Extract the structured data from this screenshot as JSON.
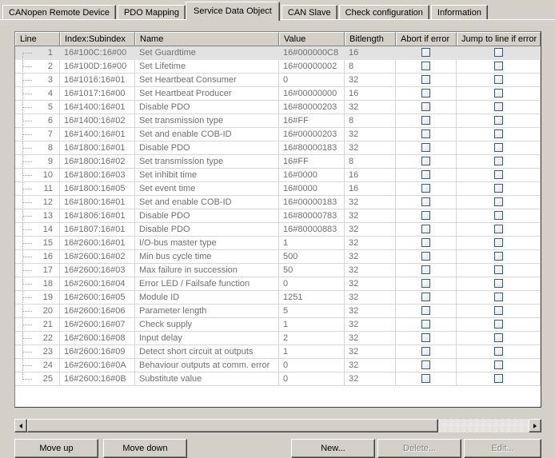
{
  "tabs": [
    {
      "label": "CANopen Remote Device",
      "active": false
    },
    {
      "label": "PDO Mapping",
      "active": false
    },
    {
      "label": "Service Data Object",
      "active": true
    },
    {
      "label": "CAN Slave",
      "active": false
    },
    {
      "label": "Check configuration",
      "active": false
    },
    {
      "label": "Information",
      "active": false
    }
  ],
  "grid": {
    "columns": [
      {
        "key": "line",
        "label": "Line"
      },
      {
        "key": "index",
        "label": "Index:Subindex"
      },
      {
        "key": "name",
        "label": "Name"
      },
      {
        "key": "value",
        "label": "Value"
      },
      {
        "key": "bit",
        "label": "Bitlength"
      },
      {
        "key": "abort",
        "label": "Abort if error"
      },
      {
        "key": "jump",
        "label": "Jump to line if error"
      }
    ],
    "selected_row": 1,
    "rows": [
      {
        "line": "1",
        "index": "16#100C:16#00",
        "name": "Set Guardtime",
        "value": "16#000000C8",
        "bit": "16",
        "abort": false,
        "jump": false
      },
      {
        "line": "2",
        "index": "16#100D:16#00",
        "name": "Set Lifetime",
        "value": "16#00000002",
        "bit": "8",
        "abort": false,
        "jump": false
      },
      {
        "line": "3",
        "index": "16#1016:16#01",
        "name": "Set Heartbeat Consumer",
        "value": "0",
        "bit": "32",
        "abort": false,
        "jump": false
      },
      {
        "line": "4",
        "index": "16#1017:16#00",
        "name": "Set Heartbeat Producer",
        "value": "16#00000000",
        "bit": "16",
        "abort": false,
        "jump": false
      },
      {
        "line": "5",
        "index": "16#1400:16#01",
        "name": "Disable PDO",
        "value": "16#80000203",
        "bit": "32",
        "abort": false,
        "jump": false
      },
      {
        "line": "6",
        "index": "16#1400:16#02",
        "name": "Set transmission type",
        "value": "16#FF",
        "bit": "8",
        "abort": false,
        "jump": false
      },
      {
        "line": "7",
        "index": "16#1400:16#01",
        "name": "Set and enable COB-ID",
        "value": "16#00000203",
        "bit": "32",
        "abort": false,
        "jump": false
      },
      {
        "line": "8",
        "index": "16#1800:16#01",
        "name": "Disable PDO",
        "value": "16#80000183",
        "bit": "32",
        "abort": false,
        "jump": false
      },
      {
        "line": "9",
        "index": "16#1800:16#02",
        "name": "Set transmission type",
        "value": "16#FF",
        "bit": "8",
        "abort": false,
        "jump": false
      },
      {
        "line": "10",
        "index": "16#1800:16#03",
        "name": "Set inhibit time",
        "value": "16#0000",
        "bit": "16",
        "abort": false,
        "jump": false
      },
      {
        "line": "11",
        "index": "16#1800:16#05",
        "name": "Set event time",
        "value": "16#0000",
        "bit": "16",
        "abort": false,
        "jump": false
      },
      {
        "line": "12",
        "index": "16#1800:16#01",
        "name": "Set and enable COB-ID",
        "value": "16#00000183",
        "bit": "32",
        "abort": false,
        "jump": false
      },
      {
        "line": "13",
        "index": "16#1806:16#01",
        "name": "Disable PDO",
        "value": "16#80000783",
        "bit": "32",
        "abort": false,
        "jump": false
      },
      {
        "line": "14",
        "index": "16#1807:16#01",
        "name": "Disable PDO",
        "value": "16#80000883",
        "bit": "32",
        "abort": false,
        "jump": false
      },
      {
        "line": "15",
        "index": "16#2600:16#01",
        "name": "I/O-bus master type",
        "value": "1",
        "bit": "32",
        "abort": false,
        "jump": false
      },
      {
        "line": "16",
        "index": "16#2600:16#02",
        "name": "Min bus cycle time",
        "value": "500",
        "bit": "32",
        "abort": false,
        "jump": false
      },
      {
        "line": "17",
        "index": "16#2600:16#03",
        "name": "Max failure in succession",
        "value": "50",
        "bit": "32",
        "abort": false,
        "jump": false
      },
      {
        "line": "18",
        "index": "16#2600:16#04",
        "name": "Error LED / Failsafe function",
        "value": "0",
        "bit": "32",
        "abort": false,
        "jump": false
      },
      {
        "line": "19",
        "index": "16#2600:16#05",
        "name": "Module ID",
        "value": "1251",
        "bit": "32",
        "abort": false,
        "jump": false
      },
      {
        "line": "20",
        "index": "16#2600:16#06",
        "name": "Parameter length",
        "value": "5",
        "bit": "32",
        "abort": false,
        "jump": false
      },
      {
        "line": "21",
        "index": "16#2600:16#07",
        "name": "Check supply",
        "value": "1",
        "bit": "32",
        "abort": false,
        "jump": false
      },
      {
        "line": "22",
        "index": "16#2600:16#08",
        "name": "Input delay",
        "value": "2",
        "bit": "32",
        "abort": false,
        "jump": false
      },
      {
        "line": "23",
        "index": "16#2600:16#09",
        "name": "Detect short circuit at outputs",
        "value": "1",
        "bit": "32",
        "abort": false,
        "jump": false
      },
      {
        "line": "24",
        "index": "16#2600:16#0A",
        "name": "Behaviour outputs at comm. error",
        "value": "0",
        "bit": "32",
        "abort": false,
        "jump": false
      },
      {
        "line": "25",
        "index": "16#2600:16#0B",
        "name": "Substitute value",
        "value": "0",
        "bit": "32",
        "abort": false,
        "jump": false
      }
    ]
  },
  "scrollbar": {
    "thumb_percent": 82
  },
  "buttons": {
    "move_up": {
      "label": "Move up",
      "enabled": true
    },
    "move_down": {
      "label": "Move down",
      "enabled": true
    },
    "new": {
      "label": "New...",
      "enabled": true
    },
    "delete": {
      "label": "Delete...",
      "enabled": false
    },
    "edit": {
      "label": "Edit...",
      "enabled": false
    }
  },
  "colors": {
    "face": "#d4d0c8",
    "grid_text": "#707070",
    "selection": "#e2e2e2",
    "checkbox_border": "#2e5c8a"
  }
}
